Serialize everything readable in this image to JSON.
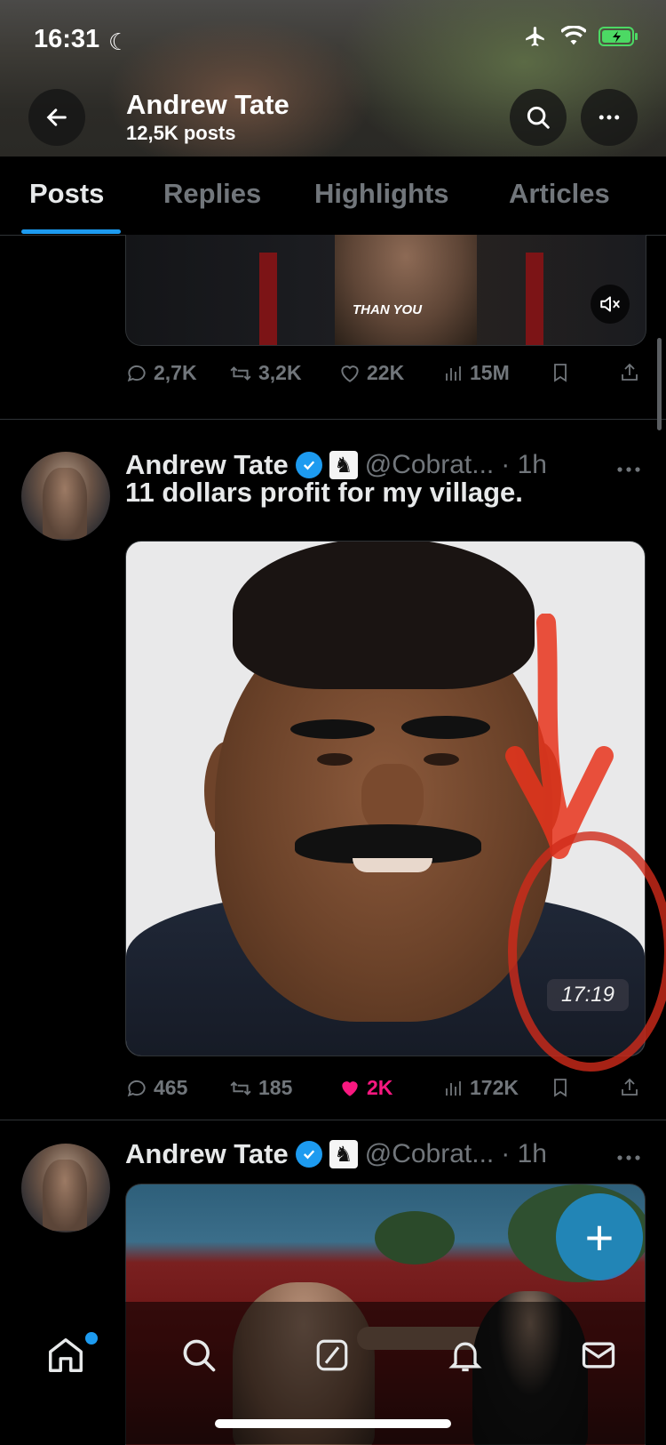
{
  "status_bar": {
    "time": "16:31"
  },
  "header": {
    "title": "Andrew Tate",
    "subtitle": "12,5K posts"
  },
  "tabs": [
    {
      "label": "Posts"
    },
    {
      "label": "Replies"
    },
    {
      "label": "Highlights"
    },
    {
      "label": "Articles"
    }
  ],
  "posts": [
    {
      "media_caption": "THAN YOU",
      "stats": {
        "replies": "2,7K",
        "reposts": "3,2K",
        "likes": "22K",
        "views": "15M"
      }
    },
    {
      "author": "Andrew Tate",
      "handle": "@Cobrat...",
      "time": "· 1h",
      "text": "11 dollars profit for my village.",
      "video_duration": "17:19",
      "stats": {
        "replies": "465",
        "reposts": "185",
        "likes": "2K",
        "views": "172K"
      }
    },
    {
      "author": "Andrew Tate",
      "handle": "@Cobrat...",
      "time": "· 1h"
    }
  ],
  "fab": {
    "label": "+"
  },
  "colors": {
    "accent": "#1d9bf0",
    "like": "#f91880",
    "muted": "#71767b"
  }
}
